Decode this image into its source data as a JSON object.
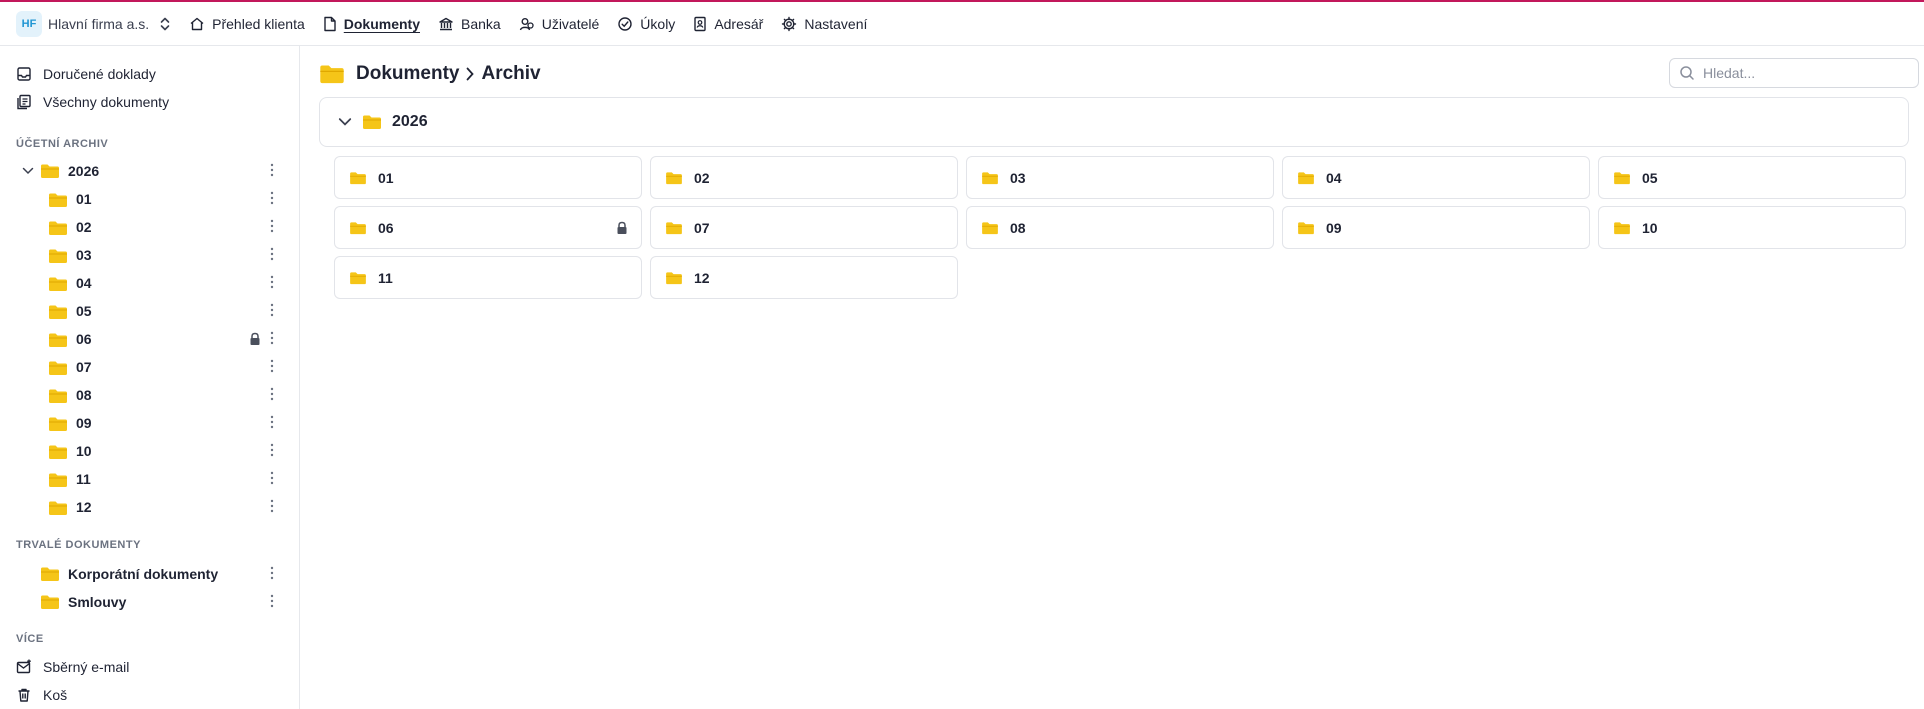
{
  "header": {
    "company_badge": "HF",
    "company_name": "Hlavní firma a.s.",
    "nav": [
      {
        "label": "Přehled klienta",
        "icon": "home-icon",
        "active": false
      },
      {
        "label": "Dokumenty",
        "icon": "document-icon",
        "active": true
      },
      {
        "label": "Banka",
        "icon": "bank-icon",
        "active": false
      },
      {
        "label": "Uživatelé",
        "icon": "users-icon",
        "active": false
      },
      {
        "label": "Úkoly",
        "icon": "check-circle-icon",
        "active": false
      },
      {
        "label": "Adresář",
        "icon": "address-book-icon",
        "active": false
      },
      {
        "label": "Nastavení",
        "icon": "gear-icon",
        "active": false
      }
    ]
  },
  "sidebar": {
    "top_links": [
      {
        "label": "Doručené doklady",
        "icon": "inbox-icon"
      },
      {
        "label": "Všechny dokumenty",
        "icon": "documents-icon"
      }
    ],
    "accounting_title": "ÚČETNÍ ARCHIV",
    "year": "2026",
    "months": [
      {
        "label": "01",
        "locked": false
      },
      {
        "label": "02",
        "locked": false
      },
      {
        "label": "03",
        "locked": false
      },
      {
        "label": "04",
        "locked": false
      },
      {
        "label": "05",
        "locked": false
      },
      {
        "label": "06",
        "locked": true
      },
      {
        "label": "07",
        "locked": false
      },
      {
        "label": "08",
        "locked": false
      },
      {
        "label": "09",
        "locked": false
      },
      {
        "label": "10",
        "locked": false
      },
      {
        "label": "11",
        "locked": false
      },
      {
        "label": "12",
        "locked": false
      }
    ],
    "permanent_title": "TRVALÉ DOKUMENTY",
    "permanent": [
      {
        "label": "Korporátní dokumenty"
      },
      {
        "label": "Smlouvy"
      }
    ],
    "more_title": "VÍCE",
    "more": [
      {
        "label": "Sběrný e-mail",
        "icon": "mail-icon"
      },
      {
        "label": "Koš",
        "icon": "trash-icon"
      }
    ]
  },
  "main": {
    "breadcrumb": {
      "root": "Dokumenty",
      "current": "Archiv"
    },
    "search_placeholder": "Hledat...",
    "year_label": "2026",
    "months": [
      {
        "label": "01",
        "locked": false
      },
      {
        "label": "02",
        "locked": false
      },
      {
        "label": "03",
        "locked": false
      },
      {
        "label": "04",
        "locked": false
      },
      {
        "label": "05",
        "locked": false
      },
      {
        "label": "06",
        "locked": true
      },
      {
        "label": "07",
        "locked": false
      },
      {
        "label": "08",
        "locked": false
      },
      {
        "label": "09",
        "locked": false
      },
      {
        "label": "10",
        "locked": false
      },
      {
        "label": "11",
        "locked": false
      },
      {
        "label": "12",
        "locked": false
      }
    ]
  },
  "colors": {
    "accent_top_border": "#c2185b",
    "folder": "#f5c518",
    "badge_bg": "#e3f2fb",
    "badge_text": "#2196d3"
  }
}
